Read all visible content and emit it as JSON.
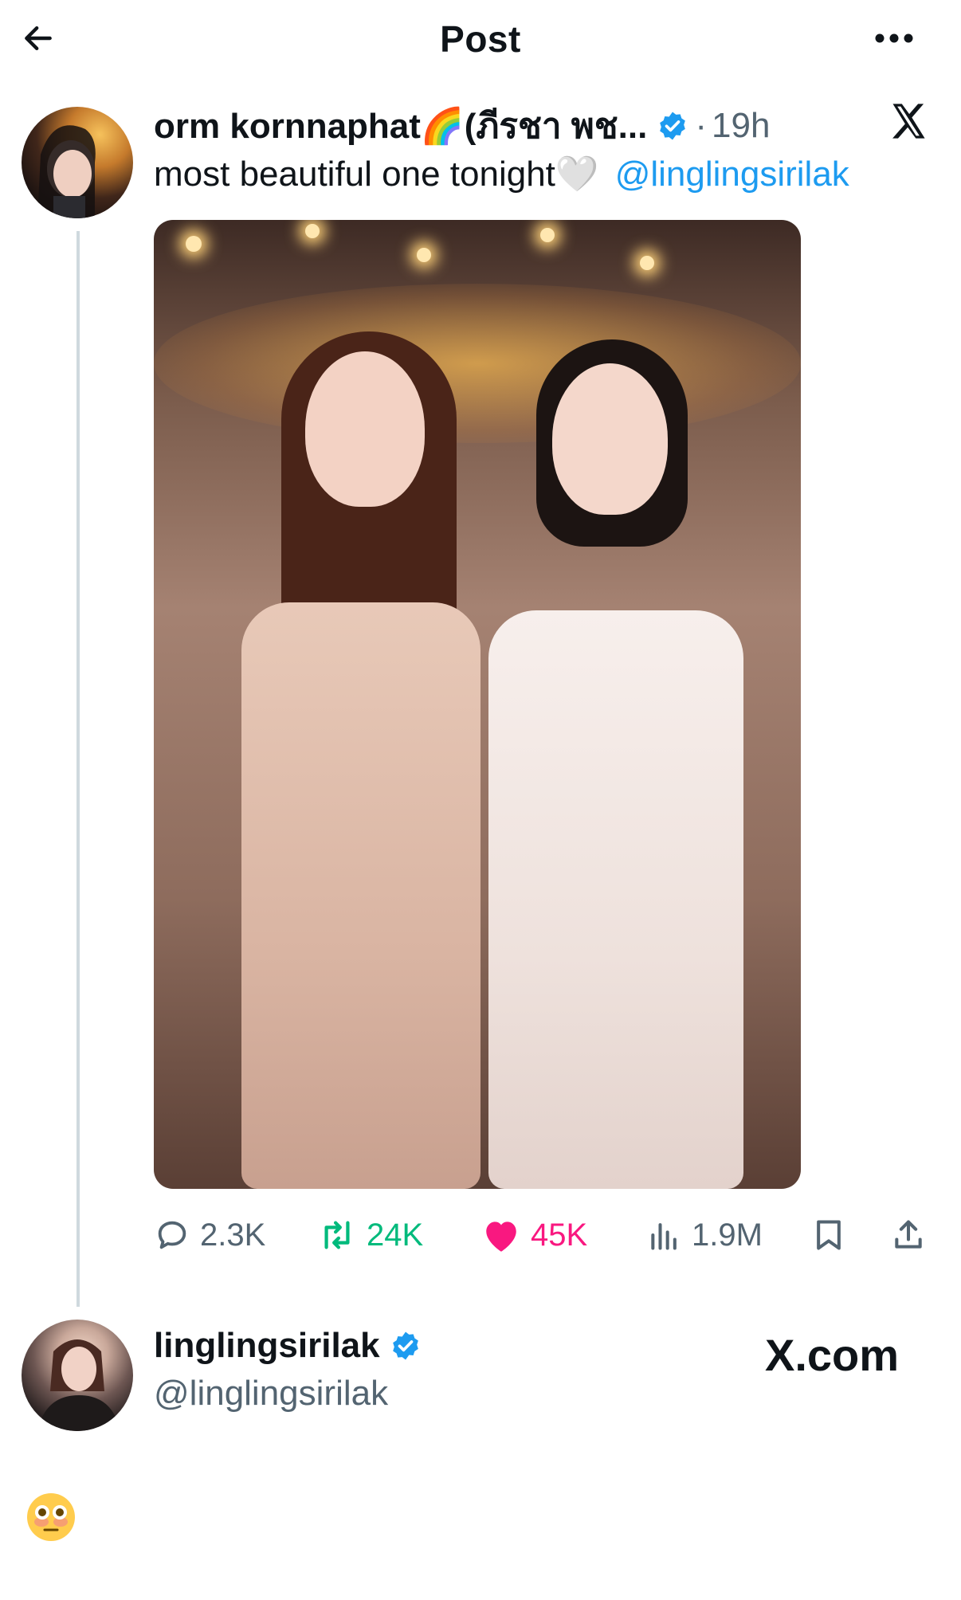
{
  "header": {
    "title": "Post"
  },
  "tweet": {
    "author_name": "orm kornnaphat🌈(ภีรชา พช...",
    "dot": "·",
    "timestamp": "19h",
    "text": "most beautiful one tonight🤍",
    "mention": "@linglingsirilak"
  },
  "actions": {
    "replies": "2.3K",
    "reposts": "24K",
    "likes": "45K",
    "views": "1.9M"
  },
  "quoted": {
    "name": "linglingsirilak",
    "handle": "@linglingsirilak",
    "watermark": "X.com",
    "emoji": "😳"
  },
  "colors": {
    "accent": "#1d9bf0",
    "repost": "#00ba7c",
    "like": "#f91880",
    "secondary_text": "#536471"
  },
  "icons": {
    "back": "arrow-left-icon",
    "more": "more-horizontal-icon",
    "verified": "verified-badge-icon",
    "x_logo": "x-logo-icon",
    "reply": "reply-icon",
    "repost": "repost-icon",
    "like": "heart-icon",
    "views": "views-icon",
    "bookmark": "bookmark-icon",
    "share": "share-icon"
  }
}
